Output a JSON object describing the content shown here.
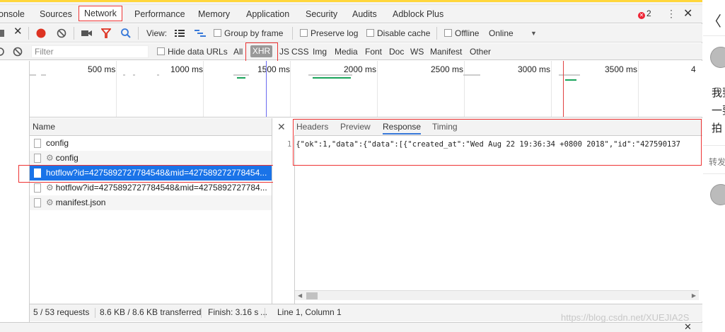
{
  "devtools": {
    "tabs": [
      "onsole",
      "Sources",
      "Network",
      "Performance",
      "Memory",
      "Application",
      "Security",
      "Audits",
      "Adblock Plus"
    ],
    "active_tab": "Network",
    "error_count": "2",
    "kebab": "⋮",
    "close": "✕"
  },
  "toolbar": {
    "view_label": "View:",
    "group_by_frame": "Group by frame",
    "preserve_log": "Preserve log",
    "disable_cache": "Disable cache",
    "offline": "Offline",
    "throttle": "Online",
    "dropdown": "▼"
  },
  "filterbar": {
    "placeholder": "Filter",
    "hide_data_urls": "Hide data URLs",
    "types": [
      "All",
      "XHR",
      "JS",
      "CSS",
      "Img",
      "Media",
      "Font",
      "Doc",
      "WS",
      "Manifest",
      "Other"
    ],
    "active_type": "XHR"
  },
  "timeline": {
    "labels": [
      "500 ms",
      "1000 ms",
      "1500 ms",
      "2000 ms",
      "2500 ms",
      "3000 ms",
      "3500 ms",
      "4"
    ]
  },
  "requests": {
    "header": "Name",
    "rows": [
      {
        "name": "config",
        "gear": false
      },
      {
        "name": "config",
        "gear": true
      },
      {
        "name": "hotflow?id=4275892727784548&mid=427589272778454...",
        "gear": false,
        "selected": true
      },
      {
        "name": "hotflow?id=4275892727784548&mid=4275892727784...",
        "gear": true
      },
      {
        "name": "manifest.json",
        "gear": true
      }
    ]
  },
  "details": {
    "close": "✕",
    "tabs": [
      "Headers",
      "Preview",
      "Response",
      "Timing"
    ],
    "active_tab": "Response",
    "line_number": "1",
    "response_text": "{\"ok\":1,\"data\":{\"data\":[{\"created_at\":\"Wed Aug 22 19:36:34 +0800 2018\",\"id\":\"427590137"
  },
  "status": {
    "requests": "5 / 53 requests",
    "transferred": "8.6 KB / 8.6 KB transferred",
    "finish": "Finish: 3.16 s",
    "trailing": "...",
    "cursor": "Line 1, Column 1"
  },
  "watermark": "https://blog.csdn.net/XUEJIA2S",
  "page": {
    "back": "〈",
    "text_lines": [
      "我要",
      "一要",
      "拍"
    ],
    "repost_label": "转发"
  }
}
